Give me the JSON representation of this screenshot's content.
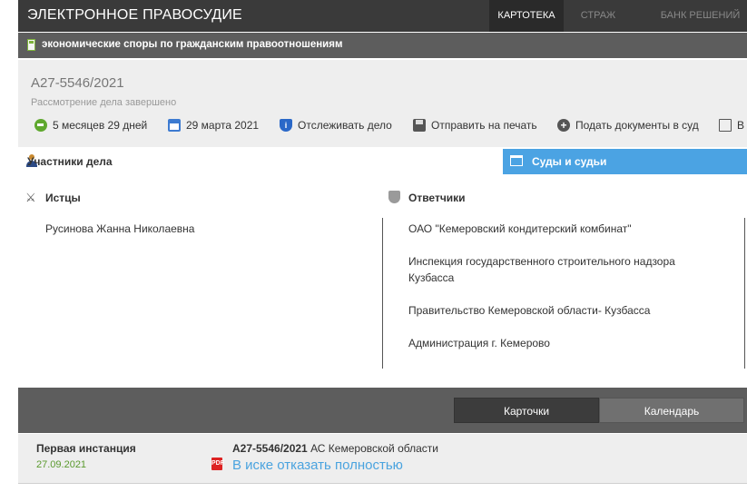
{
  "app": {
    "brand": "ЭЛЕКТРОННОЕ ПРАВОСУДИЕ",
    "nav": [
      {
        "label": "КАРТОТЕКА",
        "active": true
      },
      {
        "label": "СТРАЖ",
        "active": false
      },
      {
        "label": "БАНК РЕШЕНИЙ",
        "active": false
      }
    ]
  },
  "category": {
    "label": "экономические споры по гражданским правоотношениям"
  },
  "case": {
    "number": "А27-5546/2021",
    "status": "Рассмотрение дела завершено",
    "toolbar": {
      "duration": "5 месяцев 29 дней",
      "date": "29 марта 2021",
      "track": "Отслеживать дело",
      "print": "Отправить на печать",
      "submit": "Подать документы в суд",
      "more": "В"
    }
  },
  "tabs": {
    "participants": "Участники дела",
    "courts": "Суды и судьи"
  },
  "parties": {
    "plaintiffs_title": "Истцы",
    "defendants_title": "Ответчики",
    "plaintiffs": [
      "Русинова Жанна Николаевна"
    ],
    "defendants": [
      "ОАО \"Кемеровский кондитерский комбинат\"",
      "Инспекция государственного строительного надзора Кузбасса",
      "Правительство Кемеровской области- Кузбасса",
      "Администрация г. Кемерово"
    ]
  },
  "view_switch": {
    "cards": "Карточки",
    "calendar": "Календарь"
  },
  "instance": {
    "title": "Первая инстанция",
    "date": "27.09.2021",
    "case_number": "А27-5546/2021",
    "court": " АС Кемеровской области",
    "decision": "В иске отказать полностью",
    "pdf_label": "PDF"
  },
  "colors": {
    "topbar": "#3a3a3a",
    "accent_blue": "#4ba3e3",
    "link_blue": "#4aa3df",
    "date_green": "#5a9a2e"
  }
}
